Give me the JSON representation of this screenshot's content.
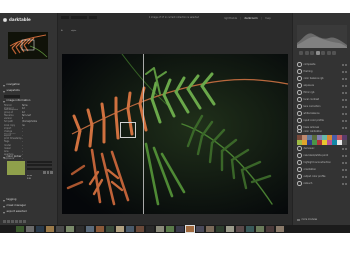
{
  "app": {
    "name": "darktable"
  },
  "topbar": {
    "title": "1 image of 17 in current collection is selected",
    "view_tabs": [
      "lighttable",
      "darkroom",
      "map",
      "slideshow"
    ],
    "active_view": "darkroom",
    "zoom_label": "fit",
    "style_label": "styles"
  },
  "left_panel": {
    "sections": [
      {
        "label": "navigation"
      },
      {
        "label": "snapshots"
      },
      {
        "label": "duplicate manager"
      },
      {
        "label": "color picker"
      },
      {
        "label": "tagging"
      },
      {
        "label": "image information"
      },
      {
        "label": "mask manager"
      },
      {
        "label": "export selected"
      }
    ],
    "snapshot_button": "take snapshot",
    "image_info": [
      {
        "k": "filmroll",
        "v": "ferns"
      },
      {
        "k": "image id",
        "v": "12"
      },
      {
        "k": "group id",
        "v": "12"
      },
      {
        "k": "filename",
        "v": "fern.nef"
      },
      {
        "k": "version",
        "v": "0"
      },
      {
        "k": "full path",
        "v": "/home/photos"
      },
      {
        "k": "local copy",
        "v": "no"
      },
      {
        "k": "import timestamp",
        "v": "-"
      },
      {
        "k": "change timestamp",
        "v": "-"
      },
      {
        "k": "export timestamp",
        "v": "-"
      },
      {
        "k": "print timestamp",
        "v": "-"
      },
      {
        "k": "flags",
        "v": "-"
      },
      {
        "k": "model",
        "v": "-"
      },
      {
        "k": "maker",
        "v": "-"
      },
      {
        "k": "lens",
        "v": "-"
      },
      {
        "k": "aperture",
        "v": "-"
      },
      {
        "k": "exposure",
        "v": "-"
      }
    ],
    "picker_mode": "mean",
    "picker_values": "RGB"
  },
  "right_panel": {
    "modules_top": [
      {
        "name": "composite"
      },
      {
        "name": "framing"
      },
      {
        "name": "color balance rgb"
      },
      {
        "name": "exposure"
      },
      {
        "name": "filmic rgb"
      },
      {
        "name": "local contrast"
      },
      {
        "name": "lens correction"
      },
      {
        "name": "white balance"
      },
      {
        "name": "input color profile"
      },
      {
        "name": "haze removal"
      }
    ],
    "color_calibration_label": "color calibration",
    "modules_bottom": [
      {
        "name": "demosaic"
      },
      {
        "name": "raw black/white point"
      },
      {
        "name": "highlight reconstruction"
      },
      {
        "name": "orientation"
      },
      {
        "name": "output color profile"
      },
      {
        "name": "retouch"
      }
    ],
    "bottom_label": "more modules"
  },
  "filmstrip": {
    "count": 27,
    "selected_index": 17
  },
  "colors": {
    "panel_bg": "#333333",
    "center_bg": "#2b2b2b",
    "swatch": "#8fa04b",
    "accent": "#e6e6e6"
  }
}
